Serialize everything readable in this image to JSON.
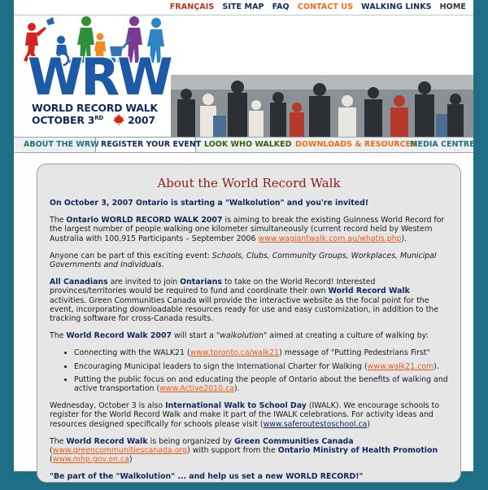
{
  "top_nav": [
    {
      "label": "FRANÇAIS",
      "color": "#b8331c"
    },
    {
      "label": "SITE MAP",
      "color": "#0f2b5b"
    },
    {
      "label": "FAQ",
      "color": "#0f2b5b"
    },
    {
      "label": "CONTACT US",
      "color": "#ef6c1a"
    },
    {
      "label": "WALKING LINKS",
      "color": "#0f2b5b"
    },
    {
      "label": "HOME",
      "color": "#333333"
    }
  ],
  "logo": {
    "letters": "WRW",
    "line1": "WORLD RECORD WALK",
    "line2_pre": "OCTOBER 3",
    "line2_sup": "RD",
    "line2_post": "2007"
  },
  "main_nav": [
    {
      "label": "ABOUT THE WRW",
      "color": "#1c6f86"
    },
    {
      "label": "REGISTER YOUR EVENT",
      "color": "#0f2b5b"
    },
    {
      "label": "LOOK WHO WALKED",
      "color": "#3c5e13"
    },
    {
      "label": "DOWNLOADS & RESOURCES",
      "color": "#ef6c1a"
    },
    {
      "label": "MEDIA CENTRE",
      "color": "#1c6f86"
    }
  ],
  "colors": {
    "page_bg": "#1e6f86",
    "heading": "#8b1c1c",
    "link": "#ee5a1a",
    "navy": "#12285c"
  },
  "content": {
    "title": "About the World Record Walk",
    "intro": "On October 3, 2007 Ontario is starting a \"Walkolution\" and you're invited!",
    "p1_pre": "The ",
    "p1_bold": "Ontario WORLD RECORD WALK 2007",
    "p1_mid": " is aiming to break the existing Guinness World Record for the largest number of people walking one kilometer simultaneously (current record held by Western Australia with 100,915 Participants – September 2006 ",
    "p1_link": "www.wagiantwalk.com.au/whatis.php",
    "p1_end": ").",
    "p2_pre": "Anyone can be part of this exciting event: ",
    "p2_italic": "Schools, Clubs, Community Groups, Workplaces, Municipal Governments and Individuals.",
    "p3_b1": "All Canadians",
    "p3_t1": " are invited to join ",
    "p3_b2": "Ontarians",
    "p3_t2": " to take on the World Record! Interested provinces/territories would be required to fund and coordinate their own ",
    "p3_b3": "World Record Walk",
    "p3_t3": " activities. Green Communities Canada will provide the interactive website as the focal point for the event, incorporating downloadable resources ready for use and easy customization, in addition to the tracking software for cross-Canada results.",
    "p4_pre": "The ",
    "p4_bold": "World Record Walk 2007",
    "p4_mid": " will start a \"",
    "p4_italic": "walkolution",
    "p4_end": "\" aimed at creating a culture of walking by:",
    "bullets": [
      {
        "pre": "Connecting with the WALK21 (",
        "link": "www.toronto.ca/walk21",
        "post": ") message of \"Putting Pedestrians First\""
      },
      {
        "pre": "Encouraging Municipal leaders to sign the International Charter for Walking (",
        "link": "www.walk21.com",
        "post": ")."
      },
      {
        "pre": "Putting the public focus on and educating the people of Ontario about the benefits of walking and active transportation (",
        "link": "www.Active2010.ca",
        "post": ")."
      }
    ],
    "p5_pre": "Wednesday, October 3 is also ",
    "p5_bold": "International Walk to School Day",
    "p5_mid": " (IWALK). We encourage schools to register for the World Record Walk and make it part of the IWALK celebrations. For activity ideas and resources designed specifically for schools please visit (",
    "p5_link": "www.saferoutestoschool.ca",
    "p5_end": ")",
    "p6_pre": "The ",
    "p6_b1": "World Record Walk",
    "p6_t1": " is being organized by ",
    "p6_b2": "Green Communities Canada",
    "p6_t2": " (",
    "p6_link1": "www.greencommunitiescanada.org",
    "p6_t3": ") with support from the ",
    "p6_b3": "Ontario Ministry of Health Promotion",
    "p6_t4": " (",
    "p6_link2": "www.mhp.gov.on.ca",
    "p6_t5": ")",
    "closing": "\"Be part of the \"Walkolution\" ... and help us set a new WORLD RECORD!\""
  }
}
